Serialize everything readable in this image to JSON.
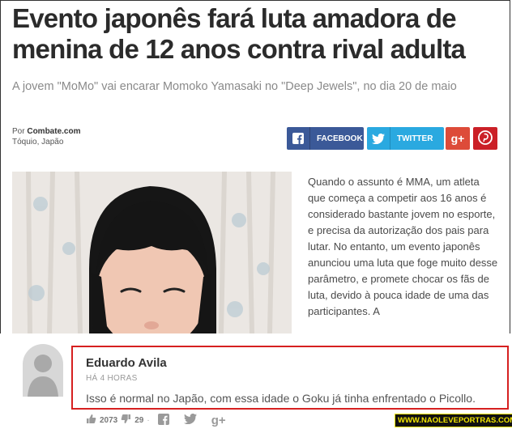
{
  "article": {
    "headline": "Evento japonês fará luta amadora de menina de 12 anos contra rival adulta",
    "subtitle": "A jovem \"MoMo\" vai encarar Momoko Yamasaki no \"Deep Jewels\", no dia 20 de maio",
    "byline_prefix": "Por",
    "source": "Combate.com",
    "location": "Tóquio, Japão",
    "body": "Quando o assunto é MMA, um atleta que começa a competir aos 16 anos é considerado bastante jovem no esporte, e precisa da autorização dos pais para lutar. No entanto, um evento japonês anunciou uma luta que foge muito desse parâmetro, e promete chocar os fãs de luta, devido à pouca idade de uma das participantes. A"
  },
  "share": {
    "facebook_label": "FACEBOOK",
    "twitter_label": "TWITTER",
    "googleplus_label": "g+",
    "colors": {
      "facebook": "#3b5998",
      "twitter": "#2aa9e0",
      "googleplus": "#dd4b39",
      "pinterest": "#cb2027"
    }
  },
  "comment": {
    "author": "Eduardo Avila",
    "time": "HÁ 4 HORAS",
    "text": "Isso é normal no Japão, com essa idade o Goku já tinha enfrentado o Picollo.",
    "likes": "2073",
    "replies": "29",
    "highlight_color": "#d62020"
  },
  "watermark": "WWW.NAOLEVEPORTRAS.COM"
}
